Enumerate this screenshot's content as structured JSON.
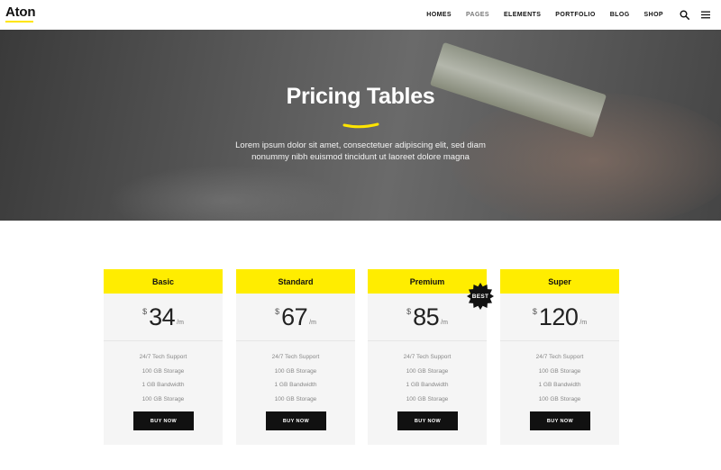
{
  "header": {
    "logo": "Aton",
    "nav": [
      "HOMES",
      "PAGES",
      "ELEMENTS",
      "PORTFOLIO",
      "BLOG",
      "SHOP"
    ],
    "icons": [
      "search-icon",
      "menu-icon"
    ]
  },
  "hero": {
    "title": "Pricing Tables",
    "subtitle_line1": "Lorem ipsum dolor sit amet, consectetuer adipiscing elit, sed diam",
    "subtitle_line2": "nonummy nibh euismod tincidunt ut laoreet dolore magna"
  },
  "plans": [
    {
      "name": "Basic",
      "currency": "$",
      "price": "34",
      "period": "/m",
      "features": [
        "24/7 Tech Support",
        "100 GB Storage",
        "1 GB Bandwidth",
        "100 GB Storage"
      ],
      "button": "BUY NOW"
    },
    {
      "name": "Standard",
      "currency": "$",
      "price": "67",
      "period": "/m",
      "features": [
        "24/7 Tech Support",
        "100 GB Storage",
        "1 GB Bandwidth",
        "100 GB Storage"
      ],
      "button": "BUY NOW"
    },
    {
      "name": "Premium",
      "currency": "$",
      "price": "85",
      "period": "/m",
      "badge": "BEST",
      "features": [
        "24/7 Tech Support",
        "100 GB Storage",
        "1 GB Bandwidth",
        "100 GB Storage"
      ],
      "button": "BUY NOW"
    },
    {
      "name": "Super",
      "currency": "$",
      "price": "120",
      "period": "/m",
      "features": [
        "24/7 Tech Support",
        "100 GB Storage",
        "1 GB Bandwidth",
        "100 GB Storage"
      ],
      "button": "BUY NOW"
    }
  ],
  "colors": {
    "accent": "#ffed00",
    "dark": "#111111"
  }
}
